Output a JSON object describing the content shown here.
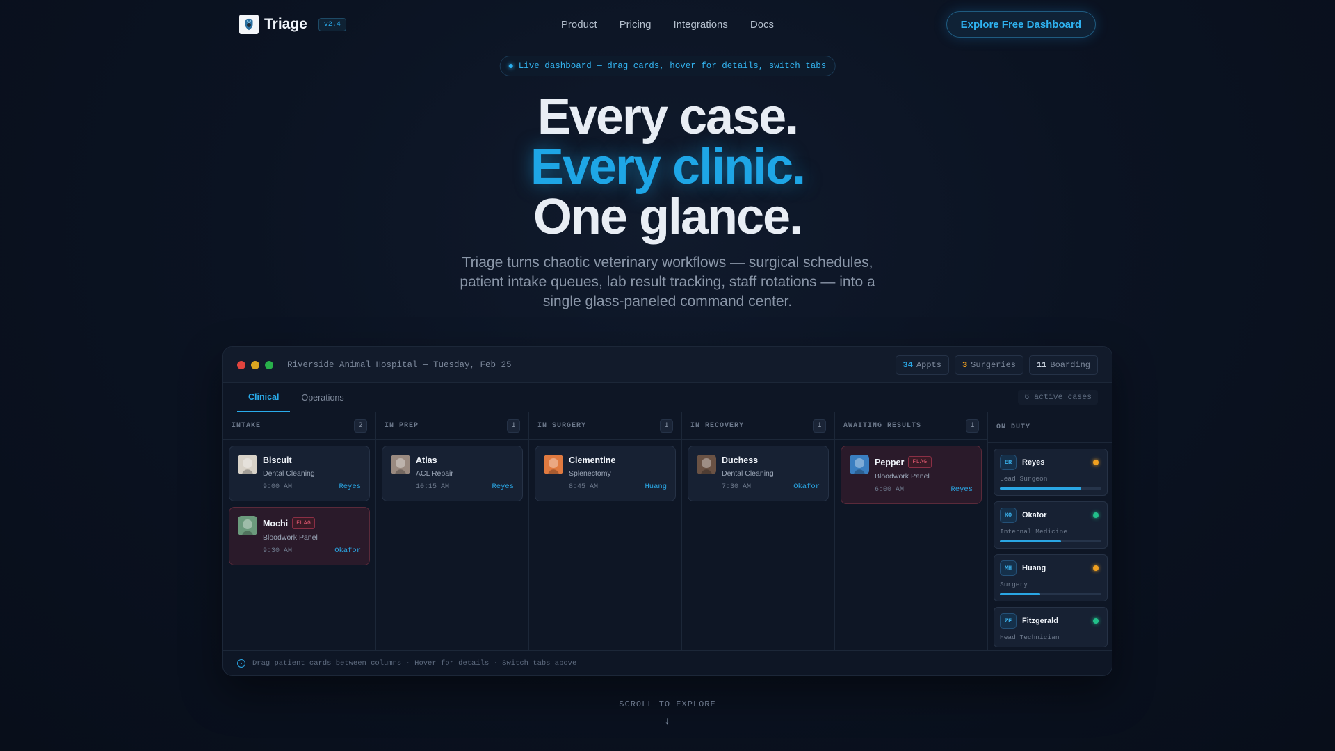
{
  "nav": {
    "brand": "Triage",
    "version": "v2.4",
    "links": [
      "Product",
      "Pricing",
      "Integrations",
      "Docs"
    ],
    "cta": "Explore Free Dashboard"
  },
  "hero": {
    "pill": "Live dashboard — drag cards, hover for details, switch tabs",
    "line1": "Every case.",
    "line2": "Every clinic.",
    "line3": "One glance.",
    "subtitle": "Triage turns chaotic veterinary workflows — surgical schedules, patient intake queues, lab result tracking, staff rotations — into a single glass-paneled command center."
  },
  "dashboard": {
    "hospital": "Riverside Animal Hospital — Tuesday, Feb 25",
    "stats": [
      {
        "value": "34",
        "label": "Appts",
        "color": "#2aa6e4"
      },
      {
        "value": "3",
        "label": "Surgeries",
        "color": "#f0a020"
      },
      {
        "value": "11",
        "label": "Boarding",
        "color": "#c9d2de"
      }
    ],
    "tabs": [
      "Clinical",
      "Operations"
    ],
    "active_cases": "6 active cases",
    "columns": [
      {
        "title": "INTAKE",
        "count": "2",
        "cards": [
          {
            "name": "Biscuit",
            "proc": "Dental Cleaning",
            "time": "9:00 AM",
            "doc": "Reyes",
            "flag": false,
            "avatar": "#d8d2c8"
          },
          {
            "name": "Mochi",
            "proc": "Bloodwork Panel",
            "time": "9:30 AM",
            "doc": "Okafor",
            "flag": true,
            "flag_label": "FLAG",
            "avatar": "#6b9a7c"
          }
        ]
      },
      {
        "title": "IN PREP",
        "count": "1",
        "cards": [
          {
            "name": "Atlas",
            "proc": "ACL Repair",
            "time": "10:15 AM",
            "doc": "Reyes",
            "flag": false,
            "avatar": "#9a8a80"
          }
        ]
      },
      {
        "title": "IN SURGERY",
        "count": "1",
        "cards": [
          {
            "name": "Clementine",
            "proc": "Splenectomy",
            "time": "8:45 AM",
            "doc": "Huang",
            "flag": false,
            "avatar": "#e07a40"
          }
        ]
      },
      {
        "title": "IN RECOVERY",
        "count": "1",
        "cards": [
          {
            "name": "Duchess",
            "proc": "Dental Cleaning",
            "time": "7:30 AM",
            "doc": "Okafor",
            "flag": false,
            "avatar": "#6a5244"
          }
        ]
      },
      {
        "title": "AWAITING RESULTS",
        "count": "1",
        "cards": [
          {
            "name": "Pepper",
            "proc": "Bloodwork Panel",
            "time": "6:00 AM",
            "doc": "Reyes",
            "flag": true,
            "flag_label": "FLAG",
            "avatar": "#3a7ec0"
          }
        ]
      }
    ],
    "duty_title": "ON DUTY",
    "staff": [
      {
        "initials": "ER",
        "name": "Reyes",
        "role": "Lead Surgeon",
        "status": "#f0a020",
        "load": 0.8
      },
      {
        "initials": "KO",
        "name": "Okafor",
        "role": "Internal Medicine",
        "status": "#22c08a",
        "load": 0.6
      },
      {
        "initials": "MH",
        "name": "Huang",
        "role": "Surgery",
        "status": "#f0a020",
        "load": 0.4
      },
      {
        "initials": "ZF",
        "name": "Fitzgerald",
        "role": "Head Technician",
        "status": "#22c08a"
      }
    ],
    "footer": "Drag patient cards between columns · Hover for details · Switch tabs above"
  },
  "scroll_label": "SCROLL TO EXPLORE",
  "icons": {
    "logo": "shield-crest-icon",
    "info": "info-icon",
    "arrow": "arrow-down-icon"
  }
}
